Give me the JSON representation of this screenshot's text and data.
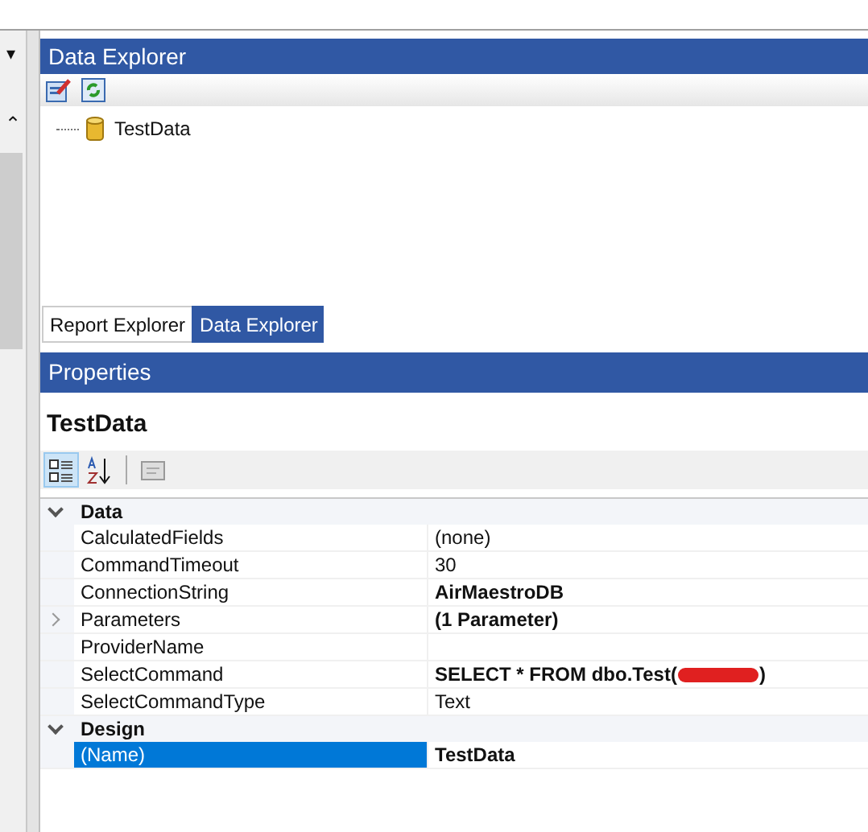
{
  "left_panel": {
    "dropdown_glyph": "▾",
    "scroll_up_glyph": "⌃"
  },
  "data_explorer": {
    "title": "Data Explorer",
    "tree": [
      {
        "label": "TestData",
        "kind": "datasource"
      }
    ]
  },
  "tabs": [
    {
      "label": "Report Explorer",
      "selected": false
    },
    {
      "label": "Data Explorer",
      "selected": true
    }
  ],
  "properties": {
    "title": "Properties",
    "object_name": "TestData",
    "toolbar": [
      {
        "kind": "categorized",
        "selected": true
      },
      {
        "kind": "alphabetical",
        "selected": false
      },
      {
        "kind": "pages",
        "selected": false
      }
    ],
    "categories": [
      {
        "name": "Data",
        "expanded": true,
        "rows": [
          {
            "name": "CalculatedFields",
            "value": "(none)",
            "bold": false,
            "expandable": false,
            "selected": false
          },
          {
            "name": "CommandTimeout",
            "value": "30",
            "bold": false,
            "expandable": false,
            "selected": false
          },
          {
            "name": "ConnectionString",
            "value": "AirMaestroDB",
            "bold": true,
            "expandable": false,
            "selected": false
          },
          {
            "name": "Parameters",
            "value": "(1 Parameter)",
            "bold": true,
            "expandable": true,
            "selected": false
          },
          {
            "name": "ProviderName",
            "expandable": false,
            "selected": false
          },
          {
            "name": "SelectCommand",
            "value": "SELECT * FROM dbo.Test(",
            "redacted": true,
            "value_after": ")",
            "bold": true,
            "expandable": false,
            "selected": false
          },
          {
            "name": "SelectCommandType",
            "value": "Text",
            "bold": false,
            "expandable": false,
            "selected": false
          }
        ]
      },
      {
        "name": "Design",
        "expanded": true,
        "rows": [
          {
            "name": "(Name)",
            "value": "TestData",
            "bold": true,
            "expandable": false,
            "selected": true
          }
        ]
      }
    ]
  }
}
